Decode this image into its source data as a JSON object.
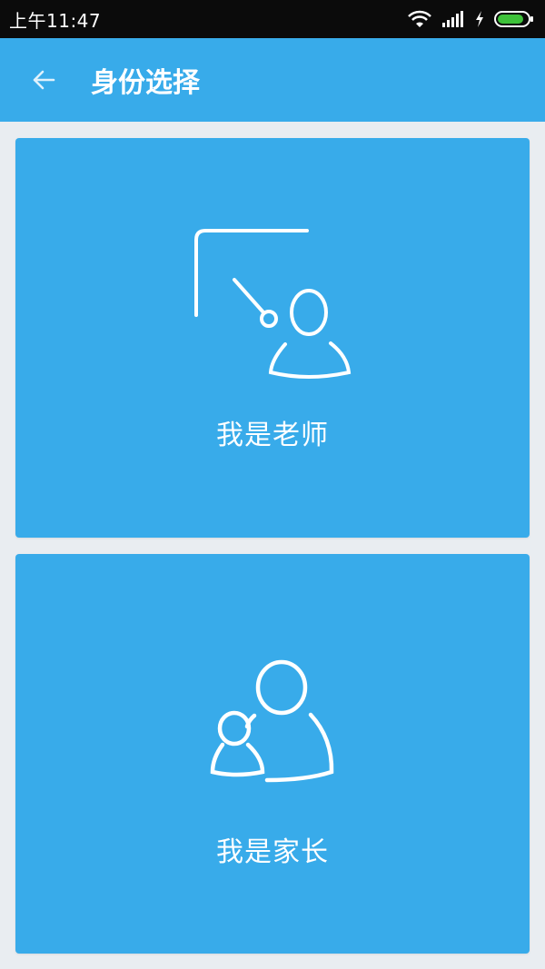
{
  "status_bar": {
    "time": "上午11:47",
    "icons": [
      "wifi-icon",
      "signal-icon",
      "charging-icon",
      "battery-icon"
    ]
  },
  "app_bar": {
    "title": "身份选择",
    "back_icon": "arrow-left-icon"
  },
  "options": {
    "teacher": {
      "label": "我是老师",
      "icon": "teacher-board-icon"
    },
    "parent": {
      "label": "我是家长",
      "icon": "parent-child-icon"
    }
  },
  "colors": {
    "primary": "#38abea",
    "background": "#e9edf1",
    "status_bar": "#0b0b0b",
    "battery_fill": "#3ec23a"
  }
}
